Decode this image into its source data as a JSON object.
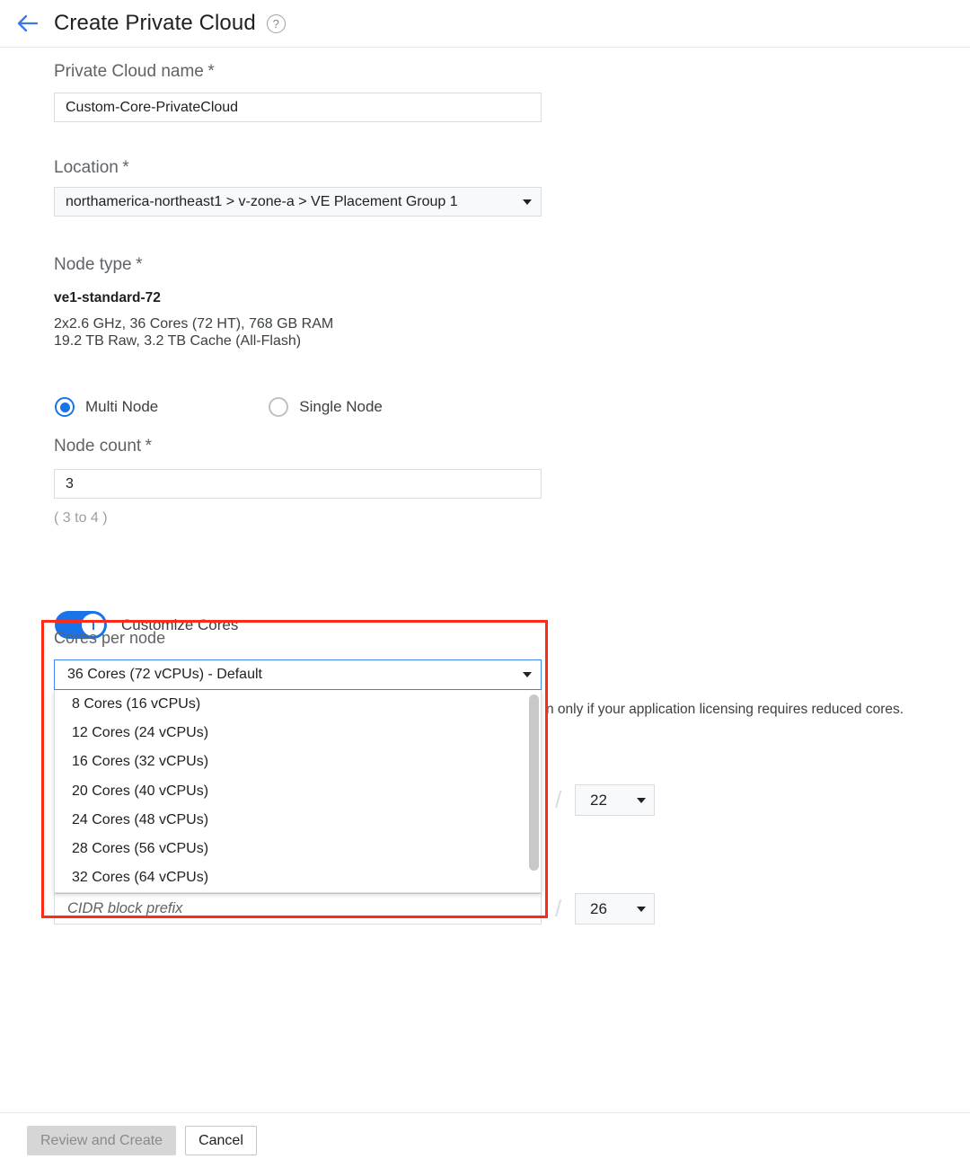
{
  "header": {
    "back_icon": "arrow-left-icon",
    "title": "Create Private Cloud",
    "help_icon": "?"
  },
  "form": {
    "private_cloud_name": {
      "label": "Private Cloud name",
      "required_mark": "*",
      "value": "Custom-Core-PrivateCloud"
    },
    "location": {
      "label": "Location",
      "required_mark": "*",
      "value": "northamerica-northeast1 > v-zone-a > VE Placement Group 1"
    },
    "node_type": {
      "label": "Node type",
      "required_mark": "*",
      "name": "ve1-standard-72",
      "spec_line_1": "2x2.6 GHz, 36 Cores (72 HT), 768 GB RAM",
      "spec_line_2": "19.2 TB Raw, 3.2 TB Cache (All-Flash)"
    },
    "node_mode": {
      "options": [
        {
          "label": "Multi Node",
          "selected": true
        },
        {
          "label": "Single Node",
          "selected": false
        }
      ]
    },
    "node_count": {
      "label": "Node count",
      "required_mark": "*",
      "value": "3",
      "range_hint": "( 3 to 4 )"
    },
    "customize_cores": {
      "label": "Customize Cores",
      "state": "on"
    },
    "cores_per_node": {
      "label": "Cores per node",
      "selected": "36 Cores (72 vCPUs) - Default",
      "options": [
        "8 Cores (16 vCPUs)",
        "12 Cores (24 vCPUs)",
        "16 Cores (32 vCPUs)",
        "20 Cores (40 vCPUs)",
        "24 Cores (48 vCPUs)",
        "28 Cores (56 vCPUs)",
        "32 Cores (64 vCPUs)"
      ]
    },
    "cores_hint_visible_text": "n only if your application licensing requires reduced cores.",
    "cidr_prefix_upper": {
      "separator": "/",
      "value": "22"
    },
    "cidr_prefix_lower": {
      "separator": "/",
      "value": "26"
    },
    "cidr_block_field": {
      "placeholder": "CIDR block prefix"
    }
  },
  "footer": {
    "review_and_create_label": "Review and Create",
    "cancel_label": "Cancel"
  },
  "colors": {
    "accent_blue": "#1a73e8",
    "highlight_red": "#ff2a17",
    "label_gray": "#5f6368",
    "border_gray": "#dadce0"
  }
}
